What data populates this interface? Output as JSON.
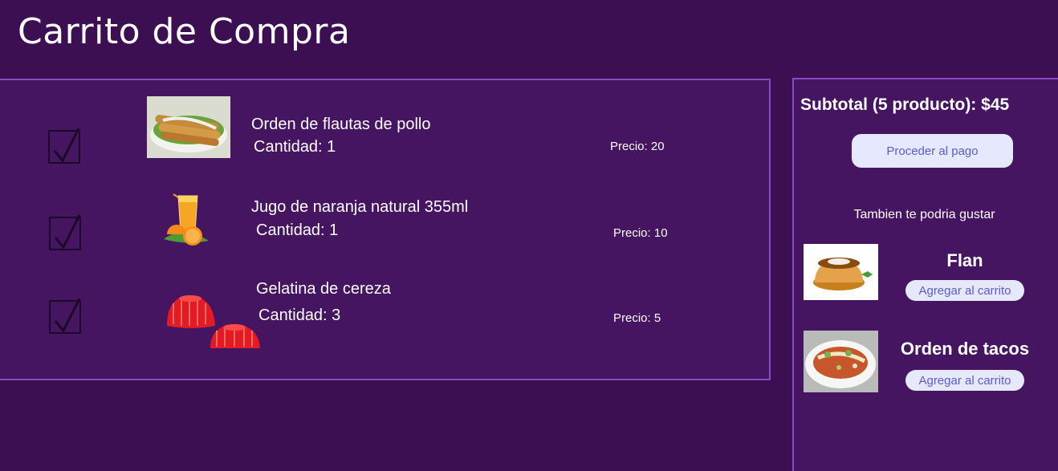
{
  "page": {
    "title": "Carrito de Compra"
  },
  "cart": {
    "items": [
      {
        "name": "Orden de flautas de pollo",
        "quantity": "Cantidad: 1",
        "price": "Precio: 20",
        "icon": "flautas-image",
        "checked": true
      },
      {
        "name": "Jugo de naranja natural 355ml",
        "quantity": "Cantidad: 1",
        "price": "Precio: 10",
        "icon": "orange-juice-image",
        "checked": true
      },
      {
        "name": "Gelatina de cereza",
        "quantity": "Cantidad: 3",
        "price": "Precio: 5",
        "icon": "cherry-gelatin-image",
        "checked": true
      }
    ]
  },
  "summary": {
    "subtotal": "Subtotal (5 producto): $45",
    "pay_label": "Proceder al pago",
    "suggest_heading": "Tambien te podria gustar",
    "suggestions": [
      {
        "name": "Flan",
        "button": "Agregar al carrito",
        "icon": "flan-image"
      },
      {
        "name": "Orden de tacos",
        "button": "Agregar al carrito",
        "icon": "tacos-image"
      }
    ]
  },
  "colors": {
    "background": "#3b0f52",
    "panel": "#461561",
    "panel_border": "#8a4cc0",
    "button_bg": "#e6e9fb",
    "button_text": "#5b5bd0"
  }
}
